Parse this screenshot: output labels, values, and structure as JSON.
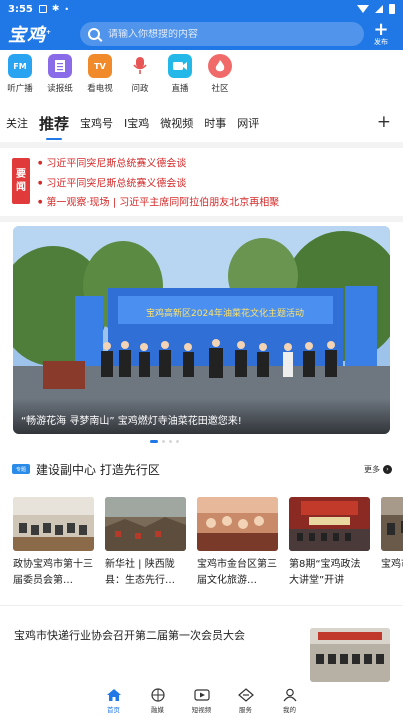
{
  "status_bar": {
    "time": "3:55"
  },
  "header": {
    "logo": "宝鸡",
    "search_placeholder": "请输入你想搜的内容",
    "publish_label": "发布"
  },
  "services": [
    {
      "label": "听广播",
      "icon": "radio-icon",
      "text": "FM",
      "color": "#2aa3f0"
    },
    {
      "label": "读报纸",
      "icon": "newspaper-icon",
      "text": "",
      "color": "#8a6be8"
    },
    {
      "label": "看电视",
      "icon": "tv-icon",
      "text": "TV",
      "color": "#f08a2a"
    },
    {
      "label": "问政",
      "icon": "microphone-icon",
      "text": "",
      "color": "#e85555"
    },
    {
      "label": "直播",
      "icon": "camera-icon",
      "text": "",
      "color": "#24b8e8"
    },
    {
      "label": "社区",
      "icon": "community-icon",
      "text": "",
      "color": "#f06a6a"
    }
  ],
  "tabs": [
    "关注",
    "推荐",
    "宝鸡号",
    "I宝鸡",
    "微视频",
    "时事",
    "网评"
  ],
  "headlines": {
    "badge_top": "要",
    "badge_bottom": "闻",
    "items": [
      "习近平同突尼斯总统赛义德会谈",
      "习近平同突尼斯总统赛义德会谈",
      "第一观察·现场 | 习近平主席同阿拉伯朋友北京再相聚"
    ]
  },
  "hero": {
    "caption": "“畅游花海 寻梦南山” 宝鸡燃灯寺油菜花田邀您来!",
    "stage_banner": "宝鸡高新区2024年油菜花文化主题活动"
  },
  "section": {
    "badge": "专题",
    "title": "建设副中心 打造先行区",
    "more": "更多"
  },
  "cards": [
    {
      "title": "政协宝鸡市第十三届委员会第…"
    },
    {
      "title": "新华社 | 陕西陇县：生态先行…"
    },
    {
      "title": "宝鸡市金台区第三届文化旅游…"
    },
    {
      "title": "第8期“宝鸡政法大讲堂”开讲"
    },
    {
      "title": "宝鸡市安全生…"
    }
  ],
  "article": {
    "title": "宝鸡市快递行业协会召开第二届第一次会员大会"
  },
  "bottom_nav": [
    {
      "label": "首页",
      "icon": "home-icon"
    },
    {
      "label": "融媒",
      "icon": "media-icon"
    },
    {
      "label": "短视频",
      "icon": "video-icon"
    },
    {
      "label": "服务",
      "icon": "service-icon"
    },
    {
      "label": "我的",
      "icon": "profile-icon"
    }
  ],
  "colors": {
    "brand": "#1f78e6",
    "headline_red": "#d42a2a"
  }
}
